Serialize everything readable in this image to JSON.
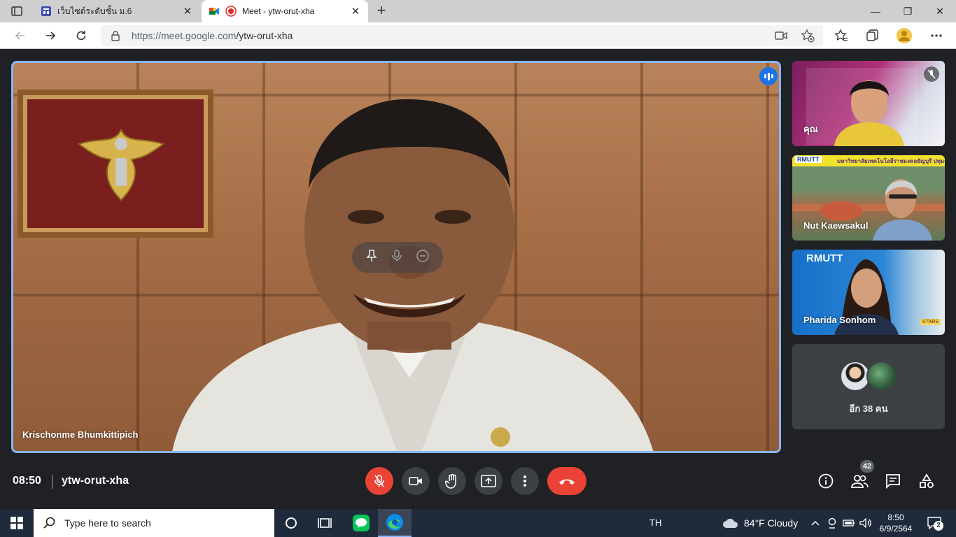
{
  "browser": {
    "tabs": [
      {
        "title": "เว็บไซต์ระดับชั้น ม.6",
        "active": false
      },
      {
        "title": "Meet - ytw-orut-xha",
        "active": true
      }
    ],
    "new_tab_label": "+",
    "url_scheme_host": "https://meet.google.com",
    "url_path": "/ytw-orut-xha",
    "window_controls": {
      "minimize": "—",
      "restore": "❐",
      "close": "✕"
    },
    "tab_close_glyph": "✕",
    "colors": {
      "tabstrip": "#cfcfcf",
      "address_bg": "#f1f3f4"
    }
  },
  "meet": {
    "main_speaker": "Krischonme Bhumkittipich",
    "participants": [
      {
        "name": "คุณ",
        "muted": true
      },
      {
        "name": "Nut Kaewsakul",
        "muted": false
      },
      {
        "name": "Pharida Sonhom",
        "muted": false
      }
    ],
    "tile_banners": {
      "tile2_banner": "มหาวิทยาลัยเทคโนโลยีราชมงคลธัญบุรี ปทุมธานี",
      "tile2_logo": "RMUTT",
      "tile3_logo": "RMUTT",
      "tile3_badge": "STARS"
    },
    "more_participants_label": "อีก 38 คน",
    "time": "08:50",
    "meeting_code": "ytw-orut-xha",
    "people_count": "42",
    "colors": {
      "hangup": "#ea4335",
      "speaking": "#1a73e8",
      "active_border": "#8ab4f8",
      "background": "#202124"
    }
  },
  "taskbar": {
    "search_placeholder": "Type here to search",
    "language": "TH",
    "weather": "84°F  Cloudy",
    "time": "8:50",
    "date": "6/9/2564",
    "notifications": "2"
  }
}
